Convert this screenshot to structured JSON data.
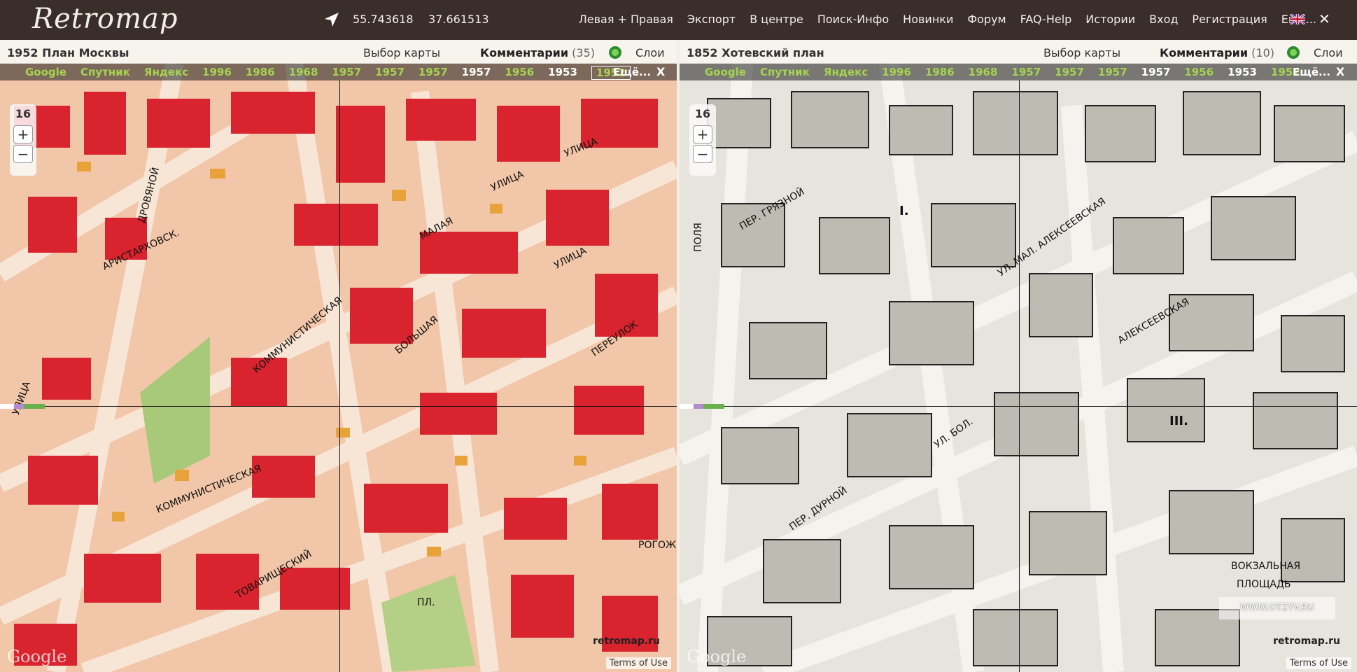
{
  "header": {
    "logo": "Retromap",
    "lat": "55.743618",
    "lon": "37.661513",
    "menu": [
      "Левая + Правая",
      "Экспорт",
      "В центре",
      "Поиск-Инфо",
      "Новинки",
      "Форум",
      "FAQ-Help",
      "Истории",
      "Вход",
      "Регистрация",
      "Ещё..."
    ],
    "close": "✕"
  },
  "left": {
    "title": "1952 План Москвы",
    "choose": "Выбор карты",
    "comments_label": "Комментарии",
    "comments_count": "(35)",
    "layers": "Слои",
    "years": [
      "Google",
      "Спутник",
      "Яндекс",
      "1996",
      "1986",
      "1968",
      "1957",
      "1957",
      "1957",
      "1957",
      "1956",
      "1953",
      "1952"
    ],
    "more": "Ещё...",
    "close": "X",
    "zoom": "16",
    "zoom_in": "+",
    "zoom_out": "−",
    "brand": "retromap.ru",
    "terms": "Terms of Use",
    "google": "Google"
  },
  "right": {
    "title": "1852 Хотевский план",
    "choose": "Выбор карты",
    "comments_label": "Комментарии",
    "comments_count": "(10)",
    "layers": "Слои",
    "years": [
      "Google",
      "Спутник",
      "Яндекс",
      "1996",
      "1986",
      "1968",
      "1957",
      "1957",
      "1957",
      "1957",
      "1956",
      "1953",
      "1952"
    ],
    "more": "Ещё...",
    "close": "X",
    "zoom": "16",
    "zoom_in": "+",
    "zoom_out": "−",
    "brand": "retromap.ru",
    "terms": "Terms of Use",
    "google": "Google"
  },
  "left_labels": [
    "УЛИЦА",
    "УЛИЦА",
    "МАЛАЯ",
    "УЛИЦА",
    "КОММУНИСТИЧЕСКАЯ",
    "БОЛЬШАЯ",
    "ПЕРЕУЛОК",
    "КОММУНИСТИЧЕСКАЯ",
    "ТОВАРИЩЕСКИЙ",
    "ПЛ.",
    "РОГОЖ",
    "УЛИЦА",
    "АРИСТАРХОВСК.",
    "ДРОВЯНОЙ"
  ],
  "right_labels": [
    "ПЕР. ГРЯЗНОЙ",
    "УЛ. МАЛ. АЛЕКСЕЕВСКАЯ",
    "АЛЕКСЕЕВСКАЯ",
    "УЛ. БОЛ.",
    "ПЕР. ДУРНОЙ",
    "ВОКЗАЛЬНАЯ",
    "ПЛОЩАДЬ",
    "III.",
    "I.",
    "ПОЛЯ"
  ],
  "watermark": "WWW.OTZYV.RU",
  "colors": {
    "topbar": "#3a2e2a",
    "accent_year": "#a6d34f",
    "building_red": "#d9232e",
    "building_orange": "#e8a23a",
    "paper_old": "#e6e4dc"
  }
}
